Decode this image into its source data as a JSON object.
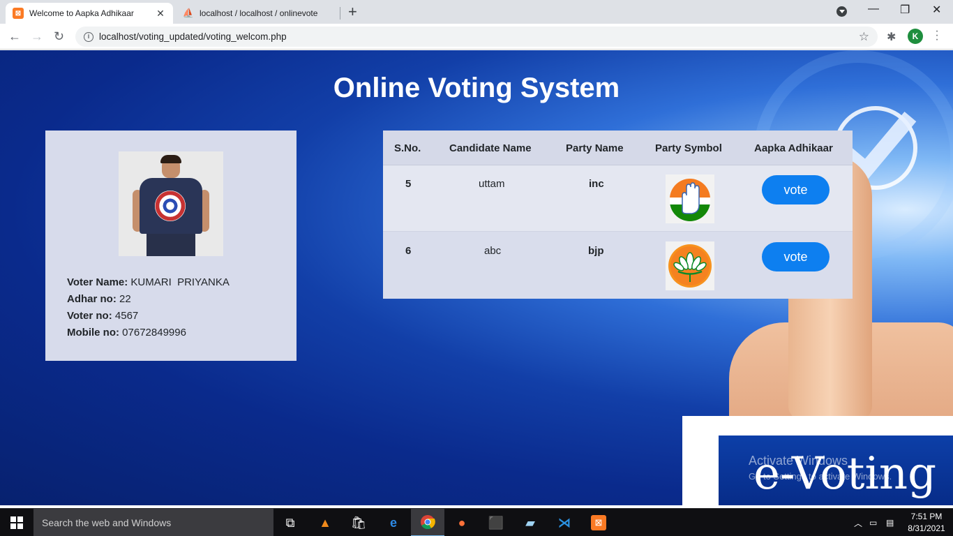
{
  "browser": {
    "tabs": [
      {
        "title": "Welcome to Aapka Adhikaar",
        "active": true,
        "favicon": "xampp-icon"
      },
      {
        "title": "localhost / localhost / onlinevote",
        "active": false,
        "favicon": "phpmyadmin-icon"
      }
    ],
    "url": "localhost/voting_updated/voting_welcom.php",
    "profile_initial": "K"
  },
  "page": {
    "title": "Online Voting System",
    "banner_text": "e-Voting",
    "watermark": {
      "line1": "Activate Windows",
      "line2": "Go to Settings to activate Windows."
    }
  },
  "voter": {
    "name_label": "Voter Name:",
    "name": "KUMARI  PRIYANKA",
    "adhar_label": "Adhar no:",
    "adhar": "22",
    "voter_no_label": "Voter no:",
    "voter_no": "4567",
    "mobile_label": "Mobile no:",
    "mobile": "07672849996"
  },
  "table": {
    "headers": {
      "sno": "S.No.",
      "candidate": "Candidate Name",
      "party": "Party Name",
      "symbol": "Party Symbol",
      "action": "Aapka Adhikaar"
    },
    "rows": [
      {
        "sno": "5",
        "candidate": "uttam",
        "party": "inc",
        "symbol": "hand-symbol-icon",
        "action": "vote"
      },
      {
        "sno": "6",
        "candidate": "abc",
        "party": "bjp",
        "symbol": "lotus-symbol-icon",
        "action": "vote"
      }
    ]
  },
  "taskbar": {
    "search_placeholder": "Search the web and Windows",
    "time": "7:51 PM",
    "date": "8/31/2021"
  },
  "colors": {
    "vote_button": "#0d7ff0",
    "page_background": "#0a2a8c",
    "card_background": "#d7dbeb"
  }
}
